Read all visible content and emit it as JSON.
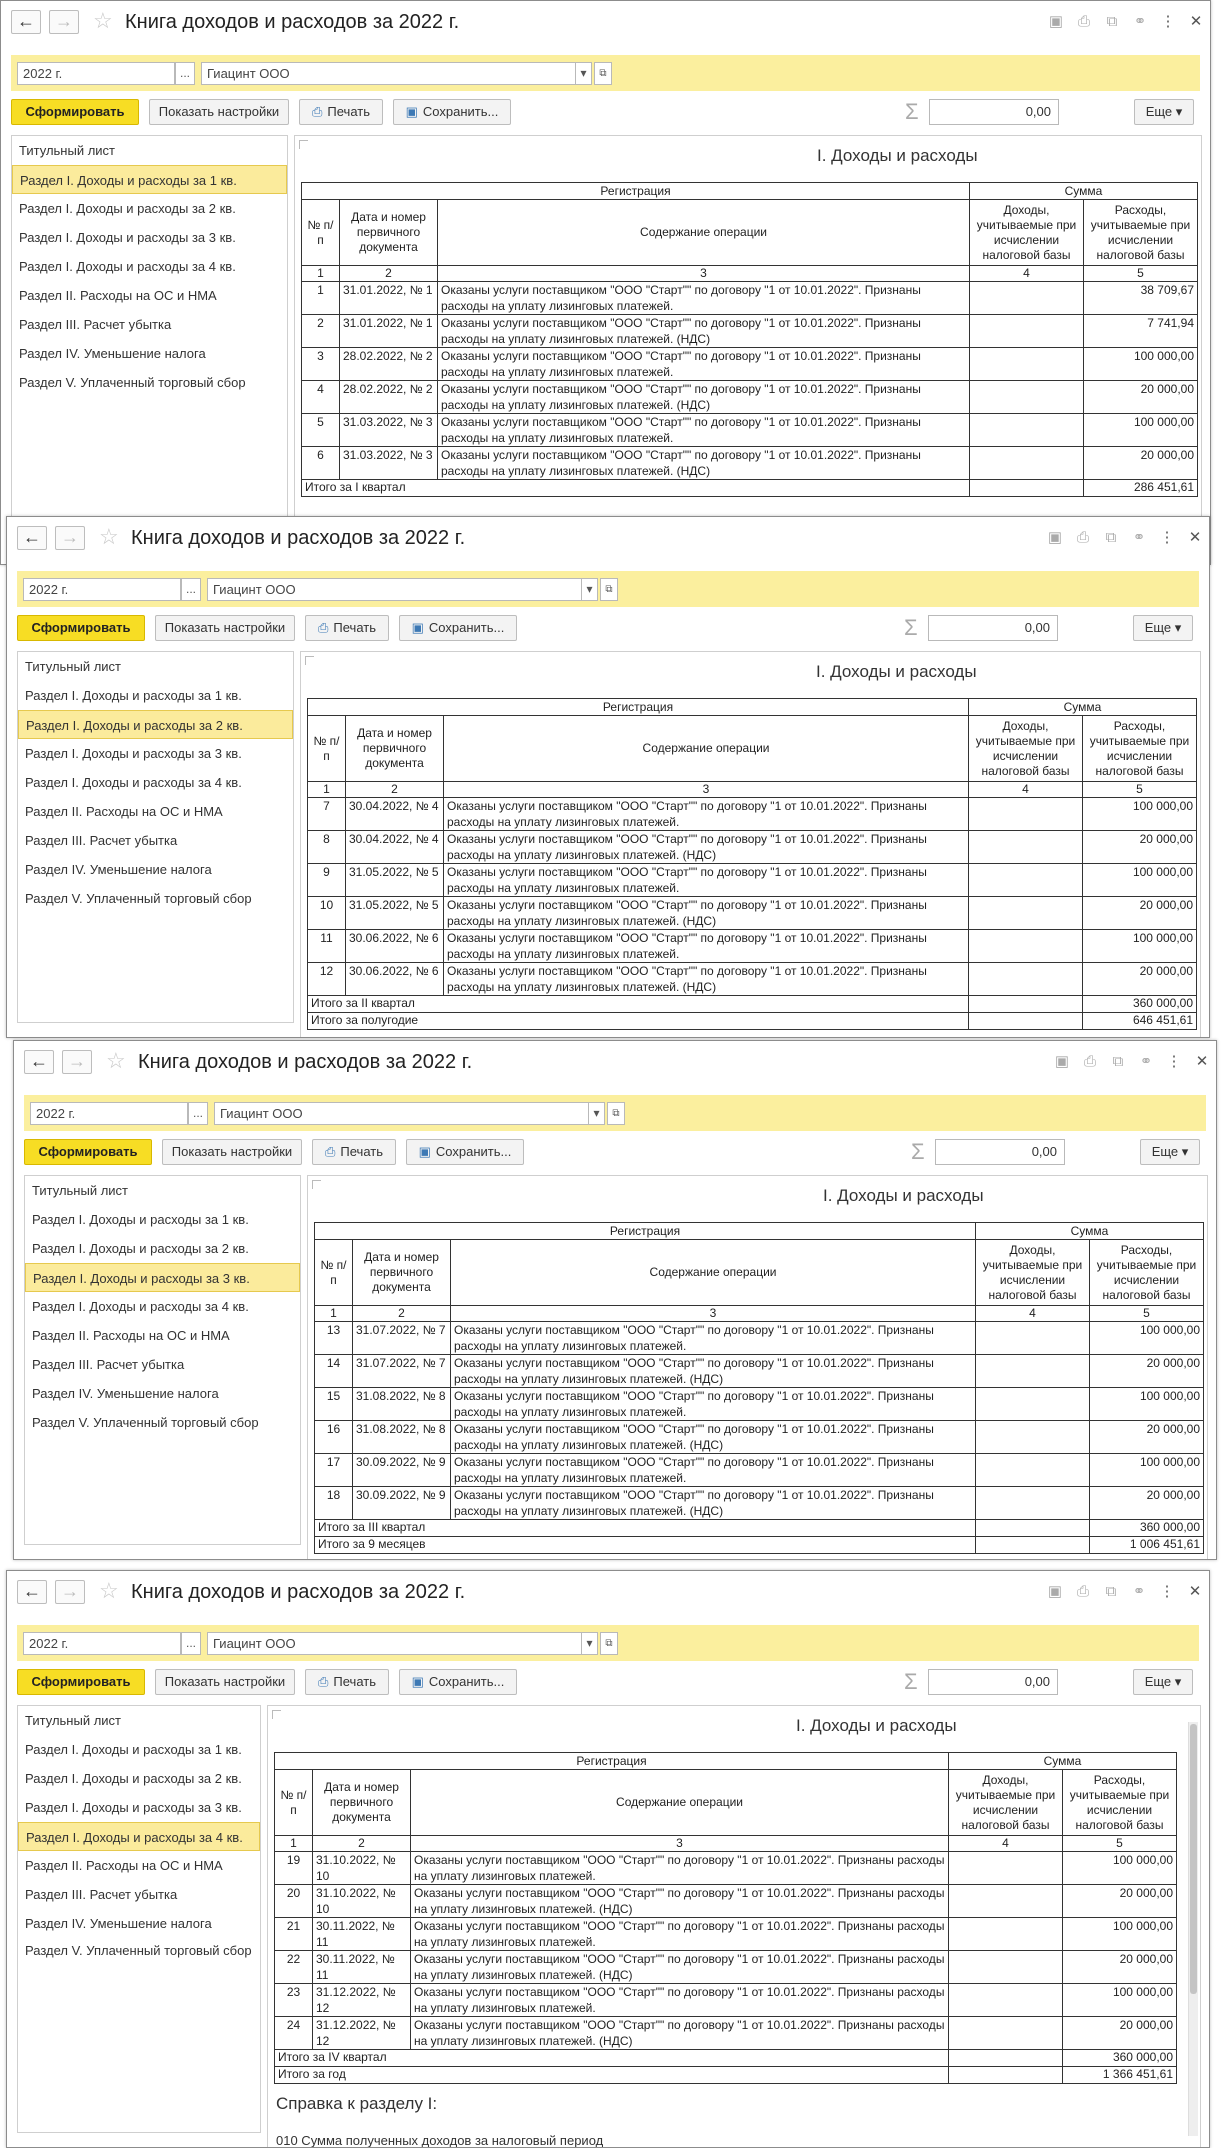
{
  "title": "Книга доходов и расходов за 2022 г.",
  "period_value": "2022 г.",
  "org_value": "Гиацинт ООО",
  "buttons": {
    "generate": "Сформировать",
    "show_settings": "Показать настройки",
    "print": "Печать",
    "save": "Сохранить...",
    "more": "Еще"
  },
  "sum_value": "0,00",
  "sidebar_items": [
    "Титульный лист",
    "Раздел I. Доходы и расходы за 1 кв.",
    "Раздел I. Доходы и расходы за 2 кв.",
    "Раздел I. Доходы и расходы за 3 кв.",
    "Раздел I. Доходы и расходы за 4 кв.",
    "Раздел II. Расходы на ОС и НМА",
    "Раздел III. Расчет убытка",
    "Раздел IV. Уменьшение налога",
    "Раздел V. Уплаченный торговый сбор"
  ],
  "report": {
    "title": "I. Доходы и расходы",
    "header": {
      "registration": "Регистрация",
      "sum": "Сумма",
      "num": "№ п/п",
      "date_doc": "Дата и номер первичного документа",
      "content": "Содержание операции",
      "income": "Доходы, учитываемые при исчислении налоговой базы",
      "expense": "Расходы, учитываемые при исчислении налоговой базы",
      "c1": "1",
      "c2": "2",
      "c3": "3",
      "c4": "4",
      "c5": "5"
    }
  },
  "windows": [
    {
      "active_section": 1,
      "rows": [
        {
          "n": "1",
          "date": "31.01.2022, № 1",
          "content": "Оказаны услуги поставщиком \"ООО \"Старт\"\" по договору \"1 от 10.01.2022\". Признаны расходы на уплату лизинговых платежей.",
          "income": "",
          "expense": "38 709,67"
        },
        {
          "n": "2",
          "date": "31.01.2022, № 1",
          "content": "Оказаны услуги поставщиком \"ООО \"Старт\"\" по договору \"1 от 10.01.2022\". Признаны расходы на уплату лизинговых платежей. (НДС)",
          "income": "",
          "expense": "7 741,94"
        },
        {
          "n": "3",
          "date": "28.02.2022, № 2",
          "content": "Оказаны услуги поставщиком \"ООО \"Старт\"\" по договору \"1 от 10.01.2022\". Признаны расходы на уплату лизинговых платежей.",
          "income": "",
          "expense": "100 000,00"
        },
        {
          "n": "4",
          "date": "28.02.2022, № 2",
          "content": "Оказаны услуги поставщиком \"ООО \"Старт\"\" по договору \"1 от 10.01.2022\". Признаны расходы на уплату лизинговых платежей. (НДС)",
          "income": "",
          "expense": "20 000,00"
        },
        {
          "n": "5",
          "date": "31.03.2022, № 3",
          "content": "Оказаны услуги поставщиком \"ООО \"Старт\"\" по договору \"1 от 10.01.2022\". Признаны расходы на уплату лизинговых платежей.",
          "income": "",
          "expense": "100 000,00"
        },
        {
          "n": "6",
          "date": "31.03.2022, № 3",
          "content": "Оказаны услуги поставщиком \"ООО \"Старт\"\" по договору \"1 от 10.01.2022\". Признаны расходы на уплату лизинговых платежей. (НДС)",
          "income": "",
          "expense": "20 000,00"
        }
      ],
      "totals": [
        {
          "label": "Итого за I квартал",
          "income": "",
          "expense": "286 451,61"
        }
      ]
    },
    {
      "active_section": 2,
      "rows": [
        {
          "n": "7",
          "date": "30.04.2022, № 4",
          "content": "Оказаны услуги поставщиком \"ООО \"Старт\"\" по договору \"1 от 10.01.2022\". Признаны расходы на уплату лизинговых платежей.",
          "income": "",
          "expense": "100 000,00"
        },
        {
          "n": "8",
          "date": "30.04.2022, № 4",
          "content": "Оказаны услуги поставщиком \"ООО \"Старт\"\" по договору \"1 от 10.01.2022\". Признаны расходы на уплату лизинговых платежей. (НДС)",
          "income": "",
          "expense": "20 000,00"
        },
        {
          "n": "9",
          "date": "31.05.2022, № 5",
          "content": "Оказаны услуги поставщиком \"ООО \"Старт\"\" по договору \"1 от 10.01.2022\". Признаны расходы на уплату лизинговых платежей.",
          "income": "",
          "expense": "100 000,00"
        },
        {
          "n": "10",
          "date": "31.05.2022, № 5",
          "content": "Оказаны услуги поставщиком \"ООО \"Старт\"\" по договору \"1 от 10.01.2022\". Признаны расходы на уплату лизинговых платежей. (НДС)",
          "income": "",
          "expense": "20 000,00"
        },
        {
          "n": "11",
          "date": "30.06.2022, № 6",
          "content": "Оказаны услуги поставщиком \"ООО \"Старт\"\" по договору \"1 от 10.01.2022\". Признаны расходы на уплату лизинговых платежей.",
          "income": "",
          "expense": "100 000,00"
        },
        {
          "n": "12",
          "date": "30.06.2022, № 6",
          "content": "Оказаны услуги поставщиком \"ООО \"Старт\"\" по договору \"1 от 10.01.2022\". Признаны расходы на уплату лизинговых платежей. (НДС)",
          "income": "",
          "expense": "20 000,00"
        }
      ],
      "totals": [
        {
          "label": "Итого за II квартал",
          "income": "",
          "expense": "360 000,00"
        },
        {
          "label": "Итого за полугодие",
          "income": "",
          "expense": "646 451,61"
        }
      ]
    },
    {
      "active_section": 3,
      "rows": [
        {
          "n": "13",
          "date": "31.07.2022, № 7",
          "content": "Оказаны услуги поставщиком \"ООО \"Старт\"\" по договору \"1 от 10.01.2022\". Признаны расходы на уплату лизинговых платежей.",
          "income": "",
          "expense": "100 000,00"
        },
        {
          "n": "14",
          "date": "31.07.2022, № 7",
          "content": "Оказаны услуги поставщиком \"ООО \"Старт\"\" по договору \"1 от 10.01.2022\". Признаны расходы на уплату лизинговых платежей. (НДС)",
          "income": "",
          "expense": "20 000,00"
        },
        {
          "n": "15",
          "date": "31.08.2022, № 8",
          "content": "Оказаны услуги поставщиком \"ООО \"Старт\"\" по договору \"1 от 10.01.2022\". Признаны расходы на уплату лизинговых платежей.",
          "income": "",
          "expense": "100 000,00"
        },
        {
          "n": "16",
          "date": "31.08.2022, № 8",
          "content": "Оказаны услуги поставщиком \"ООО \"Старт\"\" по договору \"1 от 10.01.2022\". Признаны расходы на уплату лизинговых платежей. (НДС)",
          "income": "",
          "expense": "20 000,00"
        },
        {
          "n": "17",
          "date": "30.09.2022, № 9",
          "content": "Оказаны услуги поставщиком \"ООО \"Старт\"\" по договору \"1 от 10.01.2022\". Признаны расходы на уплату лизинговых платежей.",
          "income": "",
          "expense": "100 000,00"
        },
        {
          "n": "18",
          "date": "30.09.2022, № 9",
          "content": "Оказаны услуги поставщиком \"ООО \"Старт\"\" по договору \"1 от 10.01.2022\". Признаны расходы на уплату лизинговых платежей. (НДС)",
          "income": "",
          "expense": "20 000,00"
        }
      ],
      "totals": [
        {
          "label": "Итого за III квартал",
          "income": "",
          "expense": "360 000,00"
        },
        {
          "label": "Итого за 9 месяцев",
          "income": "",
          "expense": "1 006 451,61"
        }
      ]
    },
    {
      "active_section": 4,
      "rows": [
        {
          "n": "19",
          "date": "31.10.2022, № 10",
          "content": "Оказаны услуги поставщиком \"ООО \"Старт\"\" по договору \"1 от 10.01.2022\". Признаны расходы на уплату лизинговых платежей.",
          "income": "",
          "expense": "100 000,00"
        },
        {
          "n": "20",
          "date": "31.10.2022, № 10",
          "content": "Оказаны услуги поставщиком \"ООО \"Старт\"\" по договору \"1 от 10.01.2022\". Признаны расходы на уплату лизинговых платежей. (НДС)",
          "income": "",
          "expense": "20 000,00"
        },
        {
          "n": "21",
          "date": "30.11.2022, № 11",
          "content": "Оказаны услуги поставщиком \"ООО \"Старт\"\" по договору \"1 от 10.01.2022\". Признаны расходы на уплату лизинговых платежей.",
          "income": "",
          "expense": "100 000,00"
        },
        {
          "n": "22",
          "date": "30.11.2022, № 11",
          "content": "Оказаны услуги поставщиком \"ООО \"Старт\"\" по договору \"1 от 10.01.2022\". Признаны расходы на уплату лизинговых платежей. (НДС)",
          "income": "",
          "expense": "20 000,00"
        },
        {
          "n": "23",
          "date": "31.12.2022, № 12",
          "content": "Оказаны услуги поставщиком \"ООО \"Старт\"\" по договору \"1 от 10.01.2022\". Признаны расходы на уплату лизинговых платежей.",
          "income": "",
          "expense": "100 000,00"
        },
        {
          "n": "24",
          "date": "31.12.2022, № 12",
          "content": "Оказаны услуги поставщиком \"ООО \"Старт\"\" по договору \"1 от 10.01.2022\". Признаны расходы на уплату лизинговых платежей. (НДС)",
          "income": "",
          "expense": "20 000,00"
        }
      ],
      "totals": [
        {
          "label": "Итого за IV квартал",
          "income": "",
          "expense": "360 000,00"
        },
        {
          "label": "Итого за год",
          "income": "",
          "expense": "1 366 451,61"
        }
      ],
      "reference_title": "Справка к разделу I:",
      "reference_line": "010      Сумма полученных доходов за налоговый период"
    }
  ]
}
